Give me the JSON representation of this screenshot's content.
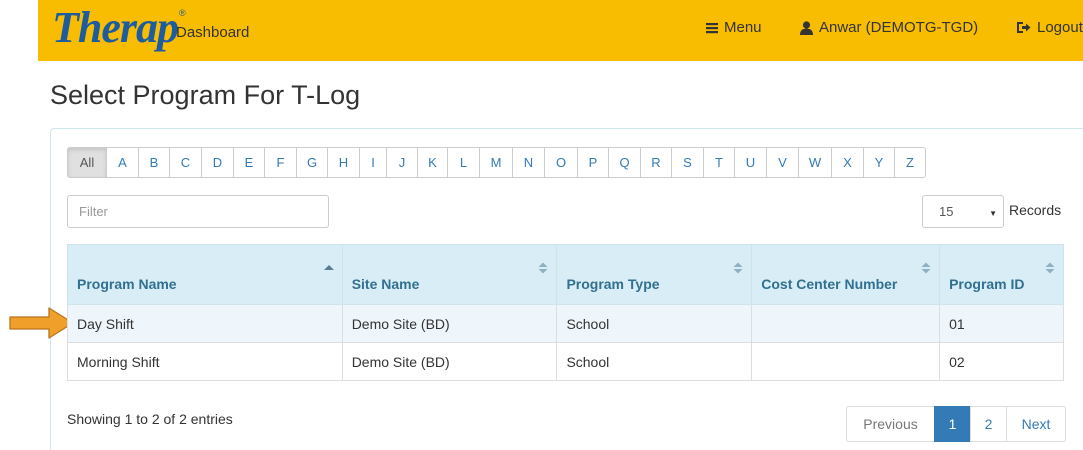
{
  "header": {
    "logo_text": "Therap",
    "logo_mark": "®",
    "dashboard_label": "Dashboard",
    "menu_label": "Menu",
    "user_label": "Anwar (DEMOTG-TGD)",
    "logout_label": "Logout",
    "bar_color": "#f8bd00",
    "icons": [
      "menu-icon",
      "user-icon",
      "logout-icon"
    ]
  },
  "page": {
    "title": "Select Program For T-Log"
  },
  "alphabet": [
    "All",
    "A",
    "B",
    "C",
    "D",
    "E",
    "F",
    "G",
    "H",
    "I",
    "J",
    "K",
    "L",
    "M",
    "N",
    "O",
    "P",
    "Q",
    "R",
    "S",
    "T",
    "U",
    "V",
    "W",
    "X",
    "Y",
    "Z"
  ],
  "alphabet_active": "All",
  "filter": {
    "placeholder": "Filter",
    "value": ""
  },
  "records": {
    "selected": "15",
    "label": "Records"
  },
  "table": {
    "columns": [
      {
        "label": "Program Name",
        "sort": "asc"
      },
      {
        "label": "Site Name",
        "sort": "both"
      },
      {
        "label": "Program Type",
        "sort": "both"
      },
      {
        "label": "Cost Center Number",
        "sort": "both"
      },
      {
        "label": "Program ID",
        "sort": "both"
      }
    ],
    "rows": [
      [
        "Day Shift",
        "Demo Site (BD)",
        "School",
        "",
        "01"
      ],
      [
        "Morning Shift",
        "Demo Site (BD)",
        "School",
        "",
        "02"
      ]
    ],
    "highlighted_row": 0,
    "header_color": "#d9edf7",
    "arrow_color": "#f0a02a"
  },
  "footer": {
    "info": "Showing 1 to 2 of 2 entries",
    "pager": {
      "previous": "Previous",
      "pages": [
        "1",
        "2"
      ],
      "active_page": "1",
      "next": "Next"
    }
  }
}
